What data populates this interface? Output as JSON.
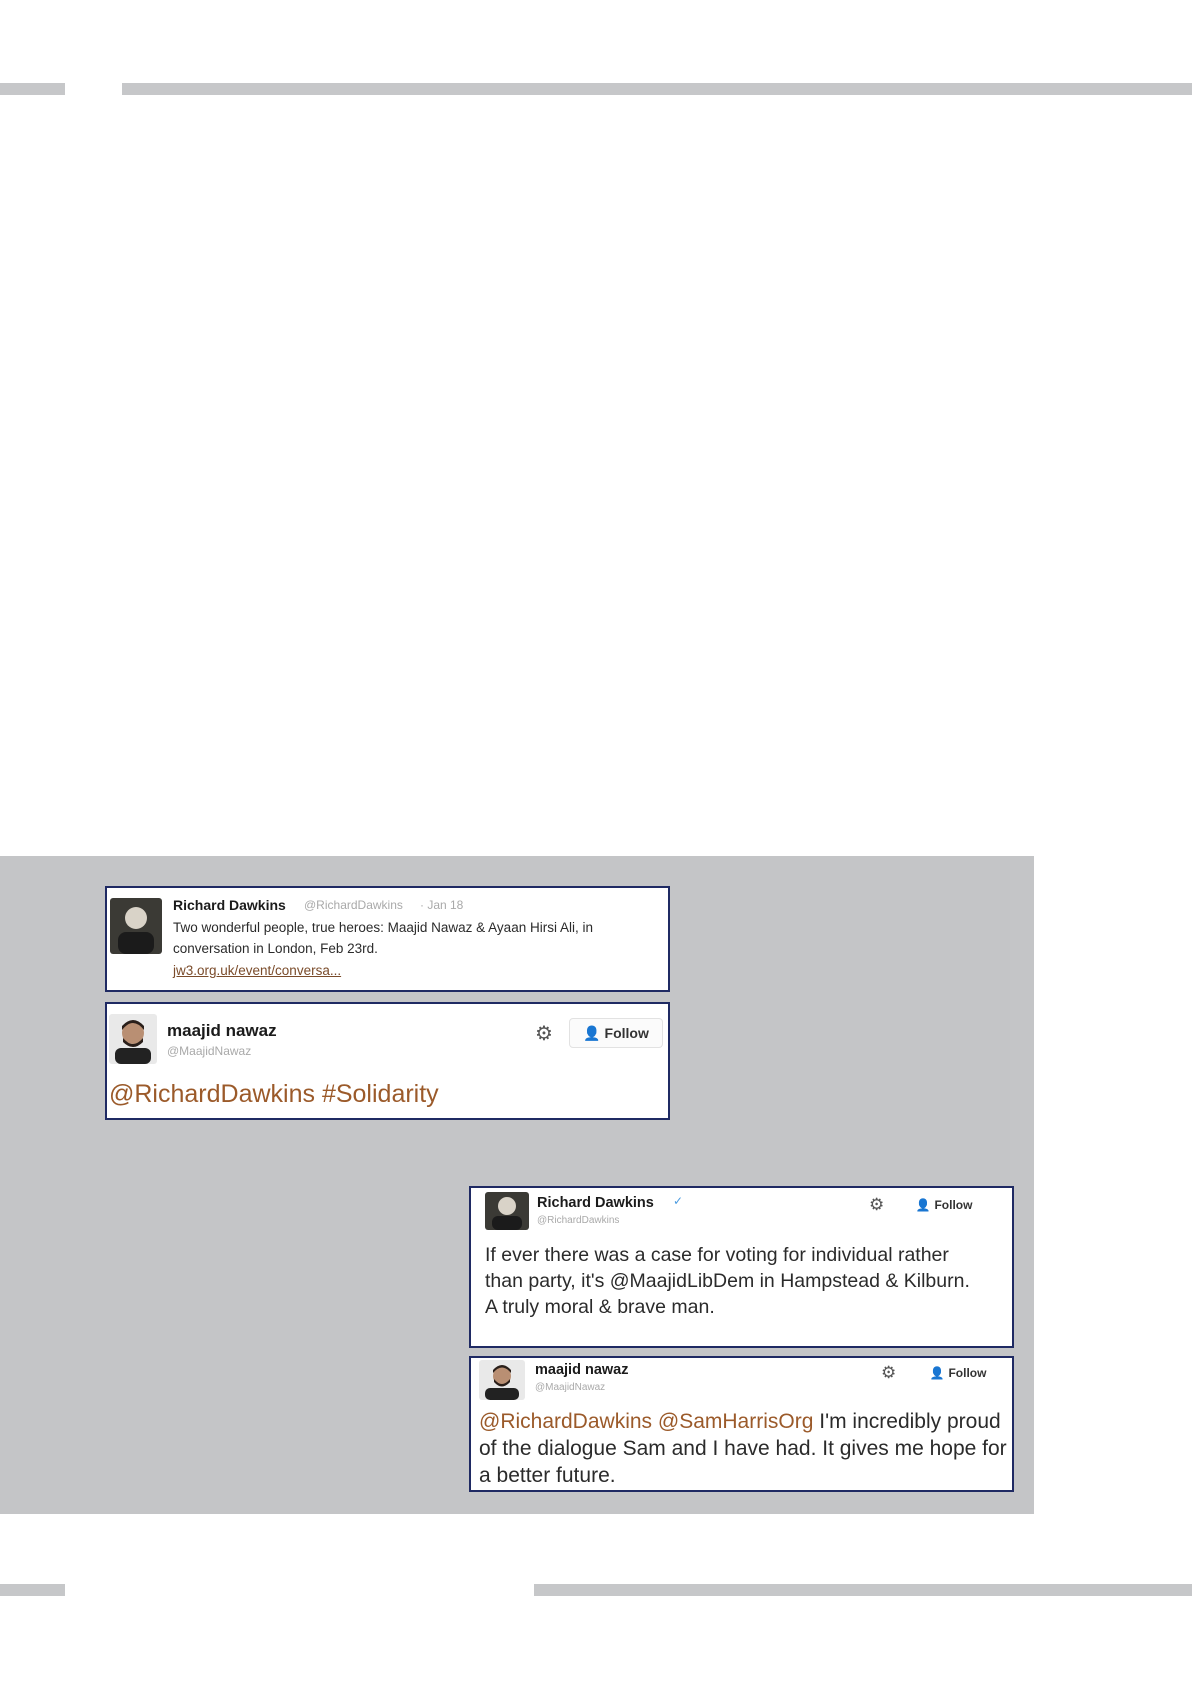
{
  "tweets": [
    {
      "name": "Richard Dawkins",
      "handle": "@RichardDawkins",
      "date": "· Jan 18",
      "text": "Two wonderful people, true heroes: Maajid Nawaz & Ayaan Hirsi Ali, in conversation in London, Feb 23rd.",
      "url": "jw3.org.uk/event/conversa..."
    },
    {
      "name": "maajid nawaz",
      "handle": "@MaajidNawaz",
      "follow_label": "Follow",
      "mention": "@RichardDawkins",
      "hashtag": "#Solidarity"
    },
    {
      "name": "Richard Dawkins",
      "handle": "@RichardDawkins",
      "verified_badge": "✓",
      "follow_label": "Follow",
      "text": "If ever there was a case for voting for individual rather than party, it's @MaajidLibDem in Hampstead & Kilburn. A truly moral & brave man."
    },
    {
      "name": "maajid nawaz",
      "handle": "@MaajidNawaz",
      "follow_label": "Follow",
      "mention1": "@RichardDawkins",
      "mention2": "@SamHarrisOrg",
      "text": "I'm incredibly proud of the dialogue Sam and I have had. It gives me hope for a better future."
    }
  ],
  "icons": {
    "gear": "gear-icon",
    "follow_person": "person-add-icon",
    "gear_glyph": "⚙",
    "person_glyph": "👤"
  },
  "colors": {
    "panel": "#c4c5c7",
    "border": "#1f2a63",
    "mention": "#9b5a2a",
    "rule": "#c6c7c9"
  }
}
